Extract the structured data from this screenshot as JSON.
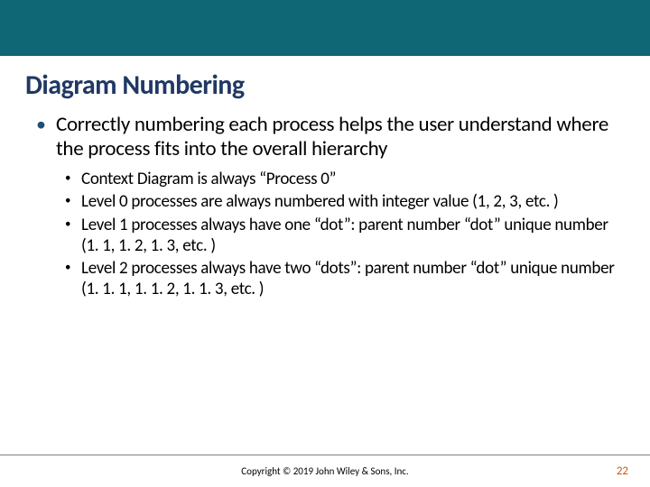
{
  "slide": {
    "title": "Diagram Numbering",
    "main_bullet": "Correctly numbering each process helps the user understand where the process fits into the overall hierarchy",
    "sub_bullets": [
      "Context Diagram is always “Process 0”",
      "Level 0 processes are always numbered with integer value (1, 2, 3, etc. )",
      "Level 1 processes always have one “dot”: parent number “dot” unique number (1. 1, 1. 2, 1. 3, etc. )",
      "Level 2 processes always have two “dots”: parent number “dot” unique number (1. 1. 1, 1. 1. 2, 1. 1. 3, etc. )"
    ]
  },
  "footer": {
    "copyright": "Copyright © 2019 John Wiley & Sons, Inc.",
    "page_number": "22"
  }
}
